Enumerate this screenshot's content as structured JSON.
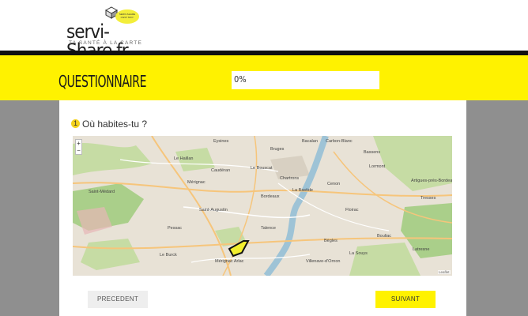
{
  "header": {
    "logo_text": "servi-Share.fr",
    "logo_tagline": "TA SANTÉ À LA CARTE",
    "logo_badge_lines": [
      "SERVI-SHARE",
      "C'EST MOI !"
    ]
  },
  "questionnaire": {
    "title": "QUESTIONNAIRE",
    "progress_text": "0%",
    "progress_fraction": 0
  },
  "question": {
    "number": "1",
    "text": "Où habites-tu ?"
  },
  "map": {
    "zoom_in": "+",
    "zoom_out": "−",
    "attribution": "Leaflet",
    "place_labels": [
      "Eysines",
      "Le Haillan",
      "Bruges",
      "Le Bouscat",
      "Lormont",
      "Mérignac",
      "Bordeaux",
      "Cenon",
      "Floirac",
      "Talence",
      "Bègles",
      "Pessac",
      "Bouliac",
      "Villenave-d'Ornon",
      "Artigues-près-Bordeaux",
      "Carbon-Blanc",
      "Bassens",
      "La Bastide",
      "Caudéran",
      "Saint-Augustin",
      "Le Burck",
      "Chartrons",
      "Saint-Médard",
      "Latresne",
      "Mérignac Arlac",
      "La Souys",
      "Bacalan",
      "Tresses"
    ],
    "colors": {
      "water": "#9ec3d6",
      "green": "#c6dca4",
      "forest": "#aacf8a",
      "urban": "#e8e2d6",
      "marker": "#f2ee2e"
    }
  },
  "navigation": {
    "prev_label": "PRECEDENT",
    "next_label": "SUIVANT"
  },
  "colors": {
    "accent_yellow": "#fff200",
    "side_gray": "#8f8f8f",
    "bar_black": "#111111"
  }
}
